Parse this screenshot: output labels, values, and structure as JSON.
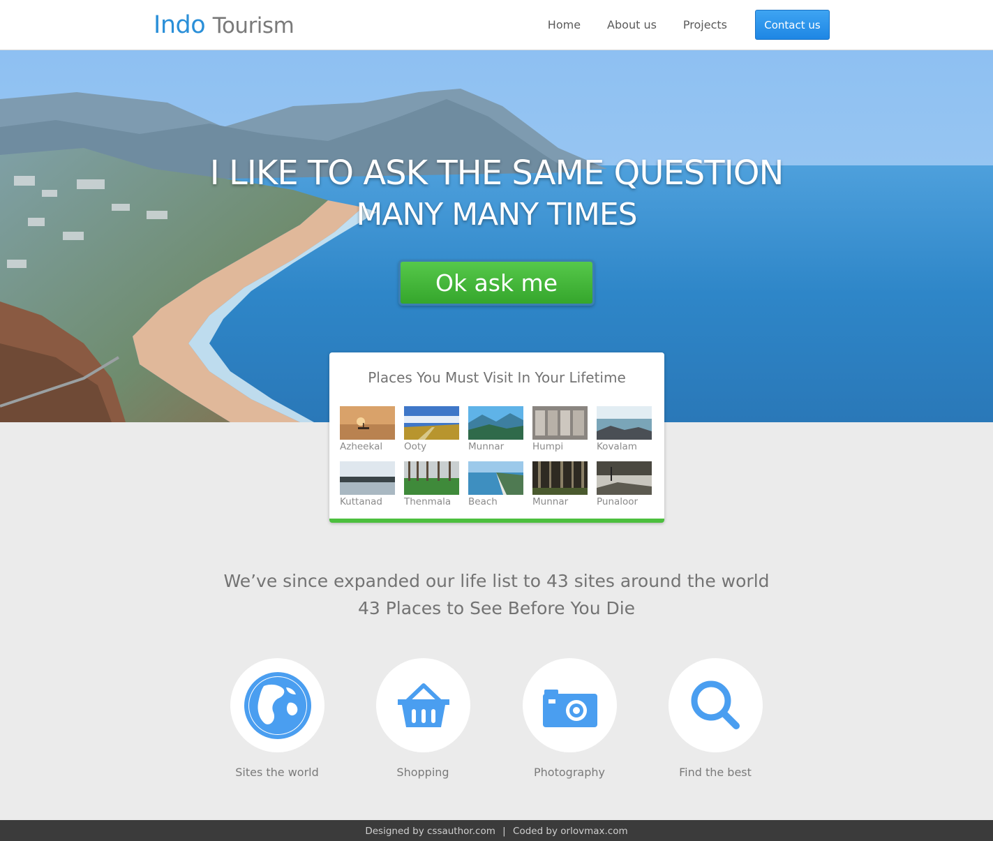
{
  "header": {
    "brand_primary": "Indo",
    "brand_secondary": "Tourism",
    "nav": [
      {
        "label": "Home"
      },
      {
        "label": "About us"
      },
      {
        "label": "Projects"
      }
    ],
    "contact_label": "Contact us"
  },
  "hero": {
    "title": "I LIKE TO ASK THE SAME QUESTION",
    "subtitle": "MANY MANY TIMES",
    "button_label": "Ok ask me"
  },
  "places": {
    "title": "Places You Must Visit In Your Lifetime",
    "items": [
      {
        "name": "Azheekal",
        "scene": "sunset-sea"
      },
      {
        "name": "Ooty",
        "scene": "grass-sky"
      },
      {
        "name": "Munnar",
        "scene": "mountains"
      },
      {
        "name": "Humpi",
        "scene": "stone-carving"
      },
      {
        "name": "Kovalam",
        "scene": "rocky-sea"
      },
      {
        "name": "Kuttanad",
        "scene": "backwater"
      },
      {
        "name": "Thenmala",
        "scene": "forest-green"
      },
      {
        "name": "Beach",
        "scene": "coast"
      },
      {
        "name": "Munnar",
        "scene": "forest-dark"
      },
      {
        "name": "Punaloor",
        "scene": "river-rocks"
      }
    ]
  },
  "intro": {
    "line1": "We’ve since expanded our life list to 43 sites around the world",
    "line2": "43 Places to See Before You Die"
  },
  "features": [
    {
      "label": "Sites the world",
      "icon": "globe-icon"
    },
    {
      "label": "Shopping",
      "icon": "basket-icon"
    },
    {
      "label": "Photography",
      "icon": "camera-icon"
    },
    {
      "label": "Find the best",
      "icon": "search-icon"
    }
  ],
  "footer": {
    "designed_by": "Designed by cssauthor.com",
    "separator": "|",
    "coded_by": "Coded by orlovmax.com"
  },
  "colors": {
    "brand_blue": "#2a8fd8",
    "icon_blue": "#4a9ef0",
    "cta_green": "#45b83a",
    "footer_bg": "#3b3b3b",
    "page_bg": "#ebebeb"
  }
}
